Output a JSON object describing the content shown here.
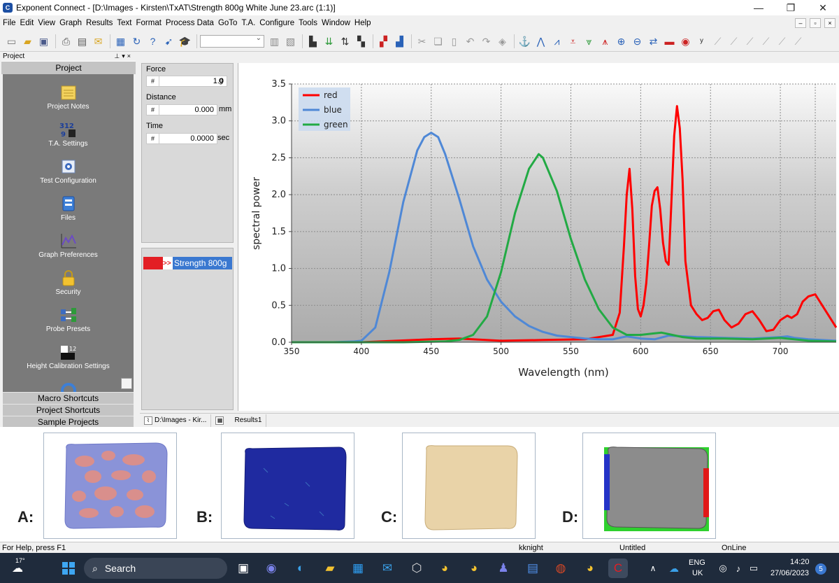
{
  "window": {
    "title": "Exponent Connect - [D:\\Images - Kirsten\\TxAT\\Strength 800g White June 23.arc (1:1)]",
    "app_icon": "exponent-logo-icon",
    "controls": [
      "minimize-icon",
      "restore-icon",
      "close-icon"
    ]
  },
  "menu": {
    "items": [
      "File",
      "Edit",
      "View",
      "Graph",
      "Results",
      "Text",
      "Format",
      "Process Data",
      "GoTo",
      "T.A.",
      "Configure",
      "Tools",
      "Window",
      "Help"
    ]
  },
  "project": {
    "header": "Project",
    "tab": "Project",
    "items": [
      {
        "label": "Project Notes",
        "icon": "notes-icon"
      },
      {
        "label": "T.A. Settings",
        "icon": "numbers-icon"
      },
      {
        "label": "Test Configuration",
        "icon": "gear-icon"
      },
      {
        "label": "Files",
        "icon": "files-icon"
      },
      {
        "label": "Graph Preferences",
        "icon": "graph-icon"
      },
      {
        "label": "Security",
        "icon": "lock-icon"
      },
      {
        "label": "Probe Presets",
        "icon": "probe-icon"
      },
      {
        "label": "Height Calibration Settings",
        "icon": "calibration-icon"
      }
    ],
    "buttons": [
      "Macro Shortcuts",
      "Project Shortcuts",
      "Sample Projects"
    ]
  },
  "readouts": {
    "force": {
      "label": "Force",
      "hash": "#",
      "value": "1.0",
      "unit": "g"
    },
    "distance": {
      "label": "Distance",
      "hash": "#",
      "value": "0.000",
      "unit": "mm"
    },
    "time": {
      "label": "Time",
      "hash": "#",
      "value": "0.0000",
      "unit": "sec"
    }
  },
  "files": {
    "selected": {
      "arrow": ">>",
      "name": "Strength 800g"
    }
  },
  "doc_tabs": [
    "D:\\Images - Kir...",
    "Results1"
  ],
  "chart_data": {
    "type": "line",
    "xlabel": "Wavelength (nm)",
    "ylabel": "spectral power",
    "xlim": [
      350,
      740
    ],
    "ylim": [
      0,
      3.5
    ],
    "xticks": [
      350,
      400,
      450,
      500,
      550,
      600,
      650,
      700
    ],
    "yticks": [
      0.0,
      0.5,
      1.0,
      1.5,
      2.0,
      2.5,
      3.0,
      3.5
    ],
    "grid": true,
    "legend": "top-left",
    "series": [
      {
        "name": "red",
        "color": "#ff0000",
        "x": [
          350,
          400,
          450,
          470,
          500,
          530,
          560,
          580,
          585,
          588,
          590,
          592,
          594,
          596,
          598,
          600,
          602,
          604,
          606,
          608,
          610,
          612,
          614,
          616,
          618,
          620,
          622,
          624,
          626,
          628,
          630,
          632,
          634,
          636,
          640,
          644,
          648,
          652,
          656,
          660,
          665,
          670,
          675,
          680,
          685,
          690,
          695,
          700,
          705,
          708,
          712,
          716,
          720,
          725,
          730,
          740
        ],
        "y": [
          0,
          0,
          0.04,
          0.05,
          0.02,
          0.03,
          0.04,
          0.1,
          0.4,
          1.3,
          2.0,
          2.35,
          1.8,
          0.9,
          0.45,
          0.35,
          0.5,
          0.8,
          1.3,
          1.85,
          2.05,
          2.1,
          1.8,
          1.35,
          1.1,
          1.05,
          1.9,
          2.8,
          3.2,
          2.9,
          2.2,
          1.1,
          0.8,
          0.5,
          0.38,
          0.3,
          0.33,
          0.42,
          0.44,
          0.3,
          0.2,
          0.25,
          0.38,
          0.42,
          0.3,
          0.15,
          0.17,
          0.3,
          0.36,
          0.33,
          0.38,
          0.55,
          0.62,
          0.65,
          0.5,
          0.2
        ]
      },
      {
        "name": "blue",
        "color": "#4f88d6",
        "x": [
          350,
          380,
          395,
          400,
          410,
          420,
          430,
          440,
          445,
          450,
          455,
          460,
          470,
          480,
          490,
          500,
          510,
          520,
          530,
          540,
          550,
          560,
          570,
          580,
          590,
          600,
          610,
          620,
          640,
          660,
          680,
          700,
          705,
          710,
          720,
          740
        ],
        "y": [
          0,
          0,
          0.01,
          0.02,
          0.2,
          0.95,
          1.9,
          2.6,
          2.78,
          2.84,
          2.78,
          2.55,
          1.95,
          1.3,
          0.85,
          0.55,
          0.35,
          0.22,
          0.14,
          0.09,
          0.07,
          0.05,
          0.04,
          0.04,
          0.08,
          0.05,
          0.04,
          0.09,
          0.07,
          0.06,
          0.05,
          0.07,
          0.08,
          0.06,
          0.04,
          0.02
        ]
      },
      {
        "name": "green",
        "color": "#22aa44",
        "x": [
          350,
          430,
          460,
          470,
          480,
          490,
          500,
          510,
          520,
          527,
          530,
          540,
          550,
          560,
          570,
          580,
          590,
          600,
          610,
          615,
          620,
          630,
          640,
          660,
          680,
          700,
          720,
          740
        ],
        "y": [
          0,
          0,
          0.01,
          0.03,
          0.1,
          0.35,
          0.95,
          1.75,
          2.35,
          2.55,
          2.5,
          2.05,
          1.4,
          0.85,
          0.45,
          0.2,
          0.1,
          0.1,
          0.12,
          0.13,
          0.11,
          0.07,
          0.05,
          0.05,
          0.04,
          0.06,
          0.02,
          0.01
        ]
      }
    ]
  },
  "samples": [
    {
      "label": "A:",
      "name": "sample-a-image"
    },
    {
      "label": "B:",
      "name": "sample-b-image"
    },
    {
      "label": "C:",
      "name": "sample-c-image"
    },
    {
      "label": "D:",
      "name": "sample-d-image"
    }
  ],
  "status": {
    "help": "For Help, press F1",
    "user": "kknight",
    "doc": "Untitled",
    "conn": "OnLine"
  },
  "taskbar": {
    "weather": "17°",
    "search": "Search",
    "lang1": "ENG",
    "lang2": "UK",
    "time": "14:20",
    "date": "27/06/2023",
    "badge": "5"
  }
}
